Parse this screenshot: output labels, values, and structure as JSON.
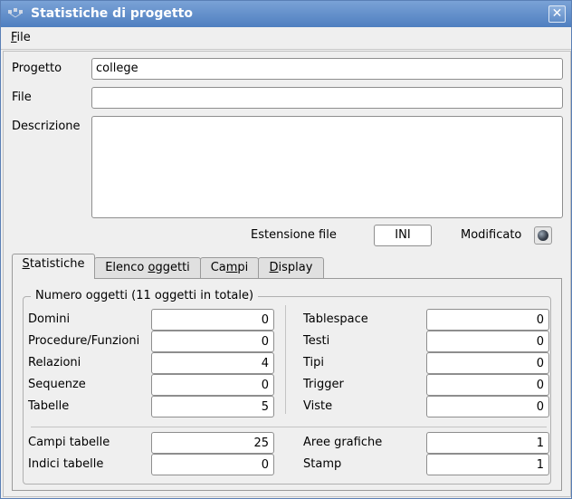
{
  "window": {
    "title": "Statistiche di progetto",
    "close_glyph": "✕",
    "icon": "app-icon"
  },
  "menu": {
    "file_first": "F",
    "file_rest": "ile"
  },
  "form": {
    "progetto_label": "Progetto",
    "progetto_value": "college",
    "file_label": "File",
    "file_value": "",
    "descrizione_label": "Descrizione",
    "descrizione_value": "",
    "estensione_label": "Estensione file",
    "estensione_value": "INI",
    "modificato_label": "Modificato"
  },
  "tabs": [
    {
      "pre": "",
      "u": "S",
      "post": "tatistiche"
    },
    {
      "pre": "Elenco ",
      "u": "o",
      "post": "ggetti"
    },
    {
      "pre": "Ca",
      "u": "m",
      "post": "pi"
    },
    {
      "pre": "",
      "u": "D",
      "post": "isplay"
    }
  ],
  "stats": {
    "group_title": "Numero oggetti (11 oggetti in totale)",
    "left": [
      {
        "label": "Domini",
        "value": "0"
      },
      {
        "label": "Procedure/Funzioni",
        "value": "0"
      },
      {
        "label": "Relazioni",
        "value": "4"
      },
      {
        "label": "Sequenze",
        "value": "0"
      },
      {
        "label": "Tabelle",
        "value": "5"
      }
    ],
    "right": [
      {
        "label": "Tablespace",
        "value": "0"
      },
      {
        "label": "Testi",
        "value": "0"
      },
      {
        "label": "Tipi",
        "value": "0"
      },
      {
        "label": "Trigger",
        "value": "0"
      },
      {
        "label": "Viste",
        "value": "0"
      }
    ],
    "bottom_left": [
      {
        "label": "Campi tabelle",
        "value": "25"
      },
      {
        "label": "Indici tabelle",
        "value": "0"
      }
    ],
    "bottom_right": [
      {
        "label": "Aree grafiche",
        "value": "1"
      },
      {
        "label": "Stamp",
        "value": "1"
      }
    ]
  }
}
